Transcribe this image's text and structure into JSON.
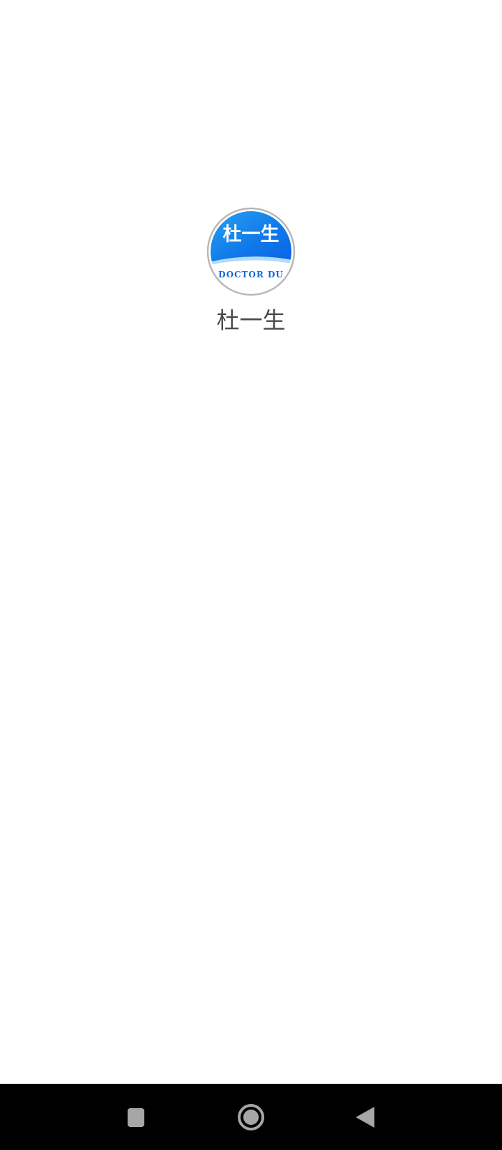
{
  "splash": {
    "logo": {
      "icon": "doctor-du-logo",
      "top_text": "杜一生",
      "bottom_text": "DOCTOR DU",
      "colors": {
        "blue_light": "#2aa6f2",
        "blue_dark": "#0a63e6",
        "bottom_text": "#1565d8",
        "ring": "#b7b7b7"
      }
    },
    "app_name": "杜一生"
  },
  "nav_bar": {
    "background": "#000000",
    "buttons": [
      {
        "name": "recent-apps",
        "icon": "square-icon"
      },
      {
        "name": "home",
        "icon": "circle-icon"
      },
      {
        "name": "back",
        "icon": "triangle-back-icon"
      }
    ],
    "icon_color": "#a6a6a6"
  }
}
